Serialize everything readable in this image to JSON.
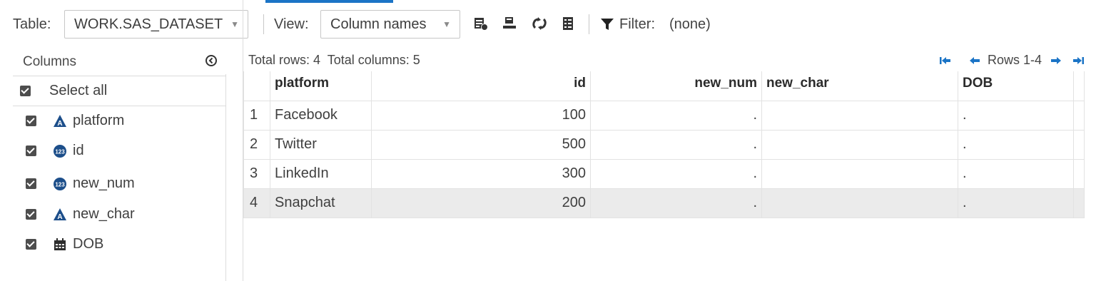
{
  "toolbar": {
    "table_label": "Table:",
    "table_value": "WORK.SAS_DATASET",
    "view_label": "View:",
    "view_value": "Column names",
    "filter_label": "Filter:",
    "filter_value": "(none)"
  },
  "columns_panel": {
    "title": "Columns",
    "select_all": "Select all",
    "items": [
      {
        "name": "platform",
        "type": "character"
      },
      {
        "name": "id",
        "type": "numeric"
      },
      {
        "name": "new_num",
        "type": "numeric"
      },
      {
        "name": "new_char",
        "type": "character"
      },
      {
        "name": "DOB",
        "type": "date"
      }
    ]
  },
  "grid": {
    "summary": "Total rows: 4  Total columns: 5",
    "rows_range": "Rows 1-4",
    "headers": [
      "platform",
      "id",
      "new_num",
      "new_char",
      "DOB"
    ],
    "rows": [
      {
        "n": "1",
        "platform": "Facebook",
        "id": "100",
        "new_num": ".",
        "new_char": "",
        "dob": "."
      },
      {
        "n": "2",
        "platform": "Twitter",
        "id": "500",
        "new_num": ".",
        "new_char": "",
        "dob": "."
      },
      {
        "n": "3",
        "platform": "LinkedIn",
        "id": "300",
        "new_num": ".",
        "new_char": "",
        "dob": "."
      },
      {
        "n": "4",
        "platform": "Snapchat",
        "id": "200",
        "new_num": ".",
        "new_char": "",
        "dob": "."
      }
    ]
  },
  "colors": {
    "accent": "#1b74c6",
    "char_icon": "#1c4e8a",
    "num_icon": "#1c4e8a",
    "selected_row": "#ebebeb"
  }
}
